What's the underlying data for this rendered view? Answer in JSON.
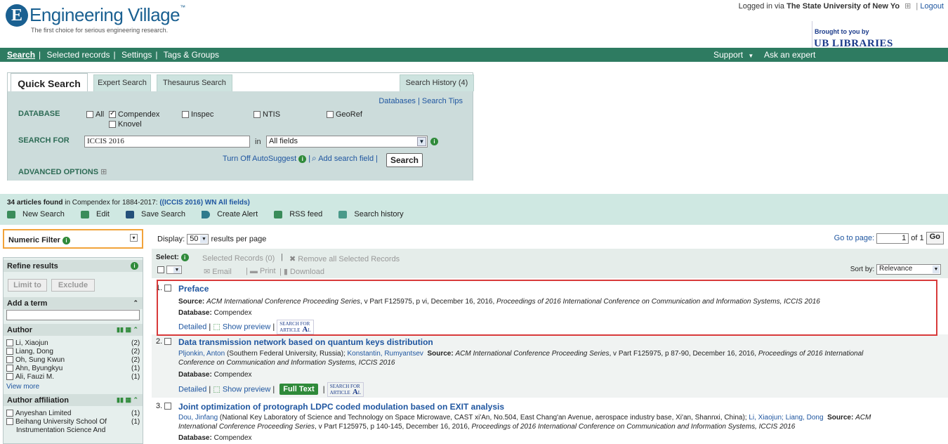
{
  "header": {
    "logo_letter": "E",
    "brand": "Engineering Village",
    "tm": "™",
    "tagline": "The first choice for serious engineering research.",
    "login_prefix": "Logged in via ",
    "login_institution": "The State University of New Yo",
    "login_expand": "⊞",
    "logout": "Logout",
    "brought_by": "Brought to you by",
    "library": "LIBRARIES",
    "library_mark": "UB"
  },
  "nav": {
    "items": [
      "Search",
      "Selected records",
      "Settings",
      "Tags & Groups"
    ],
    "support": "Support",
    "support_arrow": "▼",
    "ask": "Ask an expert"
  },
  "quick_search": {
    "tabs": {
      "quick": "Quick Search",
      "expert": "Expert Search",
      "thesaurus": "Thesaurus Search",
      "history": "Search History (4)"
    },
    "links": "Databases | Search Tips",
    "database_label": "DATABASE",
    "databases": [
      {
        "label": "All",
        "checked": false
      },
      {
        "label": "Compendex",
        "checked": true
      },
      {
        "label": "Inspec",
        "checked": false
      },
      {
        "label": "NTIS",
        "checked": false
      },
      {
        "label": "GeoRef",
        "checked": false
      },
      {
        "label": "Knovel",
        "checked": false
      }
    ],
    "search_for_label": "SEARCH FOR",
    "search_value": "ICCIS 2016",
    "in_label": "in",
    "field_value": "All fields",
    "autosuggest": "Turn Off AutoSuggest",
    "add_field": "Add search field",
    "search_btn": "Search",
    "advanced": "ADVANCED OPTIONS",
    "advanced_icon": "⊞"
  },
  "results": {
    "count_text": "34 articles found",
    "in_text": " in Compendex for 1884-2017: ",
    "query": "((ICCIS 2016) WN All fields)",
    "actions": [
      "New Search",
      "Edit",
      "Save Search",
      "Create Alert",
      "RSS feed",
      "Search history"
    ]
  },
  "sidebar": {
    "numeric_filter": "Numeric Filter",
    "refine": "Refine results",
    "limit": "Limit to",
    "exclude": "Exclude",
    "add_term": "Add a term",
    "author": "Author",
    "authors": [
      {
        "name": "Li, Xiaojun",
        "count": "(2)"
      },
      {
        "name": "Liang, Dong",
        "count": "(2)"
      },
      {
        "name": "Oh, Sung Kwun",
        "count": "(2)"
      },
      {
        "name": "Ahn, Byungkyu",
        "count": "(1)"
      },
      {
        "name": "Ali, Fauzi M.",
        "count": "(1)"
      }
    ],
    "view_more": "View more",
    "affiliation": "Author affiliation",
    "affiliations": [
      {
        "name": "Anyeshan Limited",
        "count": "(1)"
      },
      {
        "name": "Beihang University School Of",
        "count": "(1)"
      },
      {
        "name": "Instrumentation Science And",
        "count": ""
      }
    ]
  },
  "main": {
    "display": "Display:",
    "per_page": "50",
    "per_page_suffix": "results per page",
    "goto": "Go to page:",
    "page": "1",
    "of": "of 1",
    "go": "Go",
    "select": "Select:",
    "selected": "Selected Records (0)",
    "remove": "Remove all Selected Records",
    "email": "Email",
    "print": "Print",
    "download": "Download",
    "sort_by": "Sort by:",
    "sort_value": "Relevance"
  },
  "records": [
    {
      "num": "1.",
      "title": "Preface",
      "authors": "",
      "affiliation": "",
      "source_label": "Source:",
      "source": "ACM International Conference Proceeding Series",
      "source_detail": ", v Part F125975, p vi, December 16, 2016, ",
      "proceedings": "Proceedings of 2016 International Conference on Communication and Information Systems, ICCIS 2016",
      "db_label": "Database:",
      "db": "Compendex",
      "detailed": "Detailed",
      "preview": "Show preview",
      "full_text": ""
    },
    {
      "num": "2.",
      "title": "Data transmission network based on quantum keys distribution",
      "authors": "Pljonkin, Anton",
      "affiliation": " (Southern Federal University, Russia); ",
      "author2": "Konstantin, Rumyantsev",
      "source_label": "Source:",
      "source": "ACM International Conference Proceeding Series",
      "source_detail": ", v Part F125975, p 87-90, December 16, 2016, ",
      "proceedings": "Proceedings of 2016 International",
      "proceedings2": "Conference on Communication and Information Systems, ICCIS 2016",
      "db_label": "Database:",
      "db": "Compendex",
      "detailed": "Detailed",
      "preview": "Show preview",
      "full_text": "Full Text"
    },
    {
      "num": "3.",
      "title": "Joint optimization of protograph LDPC coded modulation based on EXIT analysis",
      "authors": "Dou, Jinfang",
      "affiliation": " (National Key Laboratory of Science and Technology on Space Microwave, CAST xi'An, No.504, East Chang'an Avenue, aerospace industry base, Xi'an, Shannxi, China); ",
      "author2": "Li, Xiaojun; Liang, Dong",
      "source_label": "Source:",
      "source": "ACM",
      "source2": "International Conference Proceeding Series",
      "source_detail": ", v Part F125975, p 140-145, December 16, 2016, ",
      "proceedings": "Proceedings of 2016 International Conference on Communication and Information Systems, ICCIS 2016",
      "db_label": "Database:",
      "db": "Compendex"
    }
  ],
  "sfa": {
    "top": "SEARCH FOR",
    "mid": "ARTICLE",
    "big": "A",
    "small": "L"
  }
}
